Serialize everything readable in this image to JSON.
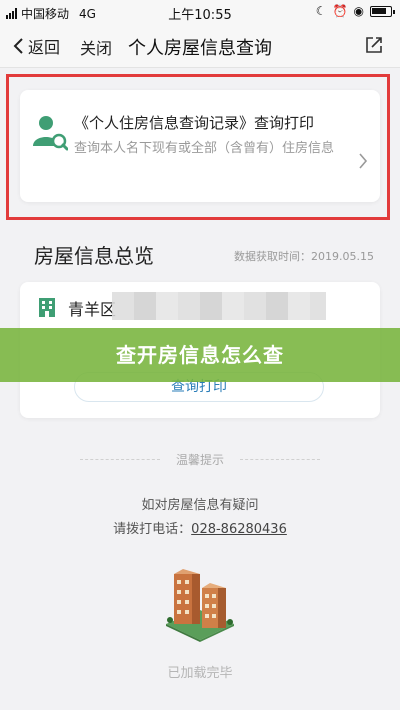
{
  "status_bar": {
    "carrier": "中国移动",
    "network": "4G",
    "time": "上午10:55"
  },
  "nav": {
    "back_label": "返回",
    "close_label": "关闭",
    "title": "个人房屋信息查询"
  },
  "record_card": {
    "title": "《个人住房信息查询记录》查询打印",
    "description": "查询本人名下现有或全部（含曾有）住房信息"
  },
  "overview": {
    "title": "房屋信息总览",
    "fetch_time": "数据获取时间：2019.05.15"
  },
  "house_card": {
    "name": "青羊区",
    "print_button": "查询打印"
  },
  "banner": {
    "text": "查开房信息怎么查"
  },
  "tips": {
    "label": "温馨提示",
    "question": "如对房屋信息有疑问",
    "phone_prefix": "请拨打电话：",
    "phone_number": "028-86280436"
  },
  "footer": {
    "loaded": "已加载完毕"
  },
  "colors": {
    "highlight": "#e23b3b",
    "accent_green": "#3f9e74",
    "link_blue": "#2a7db8",
    "banner_green": "#78b43c"
  }
}
